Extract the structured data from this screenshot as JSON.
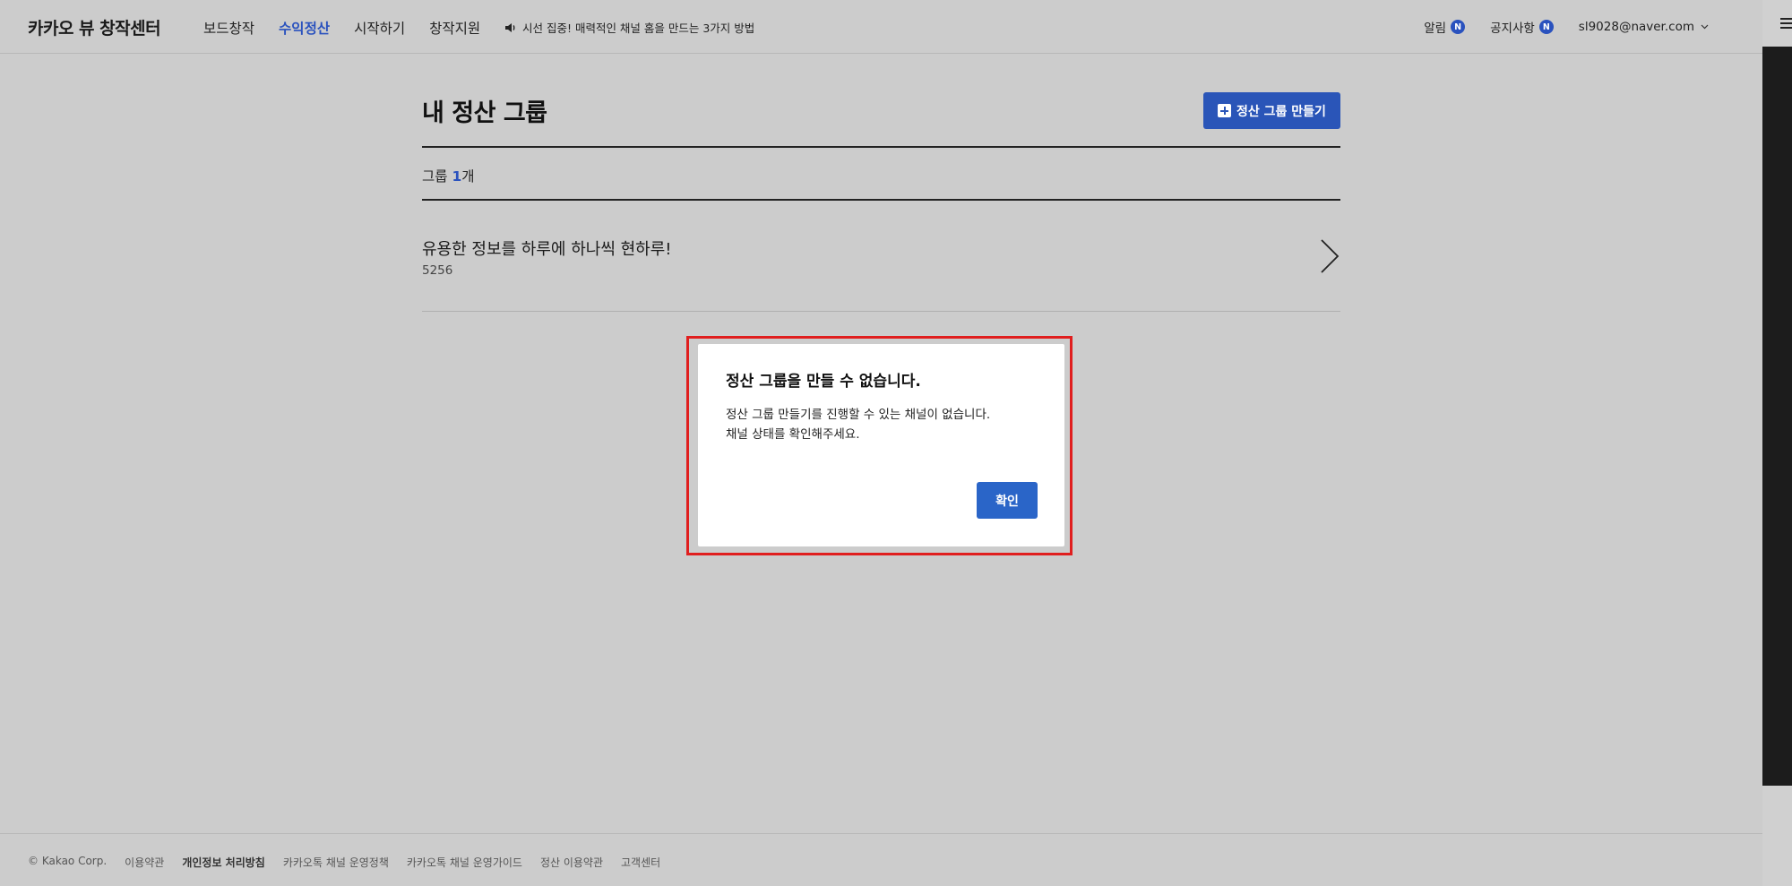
{
  "header": {
    "logo": "카카오 뷰 창작센터",
    "nav": [
      {
        "label": "보드창작",
        "active": false
      },
      {
        "label": "수익정산",
        "active": true
      },
      {
        "label": "시작하기",
        "active": false
      },
      {
        "label": "창작지원",
        "active": false
      }
    ],
    "notice": "시선 집중! 매력적인 채널 홈을 만드는 3가지 방법",
    "alerts_label": "알림",
    "alerts_badge": "N",
    "notices_label": "공지사항",
    "notices_badge": "N",
    "account": "sl9028@naver.com"
  },
  "main": {
    "title": "내 정산 그룹",
    "create_button": "정산 그룹 만들기",
    "count_prefix": "그룹 ",
    "count_value": "1",
    "count_suffix": "개",
    "groups": [
      {
        "name": "유용한 정보를 하루에 하나씩 현하루!",
        "id": "5256"
      }
    ]
  },
  "modal": {
    "title": "정산 그룹을 만들 수 없습니다.",
    "line1": "정산 그룹 만들기를 진행할 수 있는 채널이 없습니다.",
    "line2": "채널 상태를 확인해주세요.",
    "confirm": "확인"
  },
  "footer": {
    "copyright": "© Kakao Corp.",
    "links": [
      {
        "label": "이용약관",
        "bold": false
      },
      {
        "label": "개인정보 처리방침",
        "bold": true
      },
      {
        "label": "카카오톡 채널 운영정책",
        "bold": false
      },
      {
        "label": "카카오톡 채널 운영가이드",
        "bold": false
      },
      {
        "label": "정산 이용약관",
        "bold": false
      },
      {
        "label": "고객센터",
        "bold": false
      }
    ]
  },
  "colors": {
    "accent": "#2a52be",
    "highlight_outline": "#e01e1e",
    "overlay_bg": "#cccccc"
  }
}
